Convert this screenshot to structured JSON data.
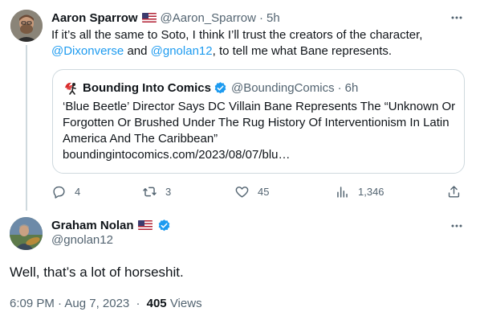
{
  "tweet1": {
    "name": "Aaron Sparrow",
    "handle": "@Aaron_Sparrow",
    "time": "5h",
    "text_a": "If it’s all the same to Soto, I think I’ll trust the creators of the character,",
    "mention_1": "@Dixonverse",
    "text_and": "and",
    "mention_2": "@gnolan12",
    "text_b": ", to tell me what Bane represents.",
    "quote": {
      "name": "Bounding Into Comics",
      "handle": "@BoundingComics",
      "time": "6h",
      "text": "‘Blue Beetle’ Director Says DC Villain Bane Represents The “Unknown Or Forgotten Or Brushed Under The Rug History Of Interventionism In Latin America And The Caribbean”",
      "link": "boundingintocomics.com/2023/08/07/blu…"
    },
    "actions": {
      "replies": "4",
      "retweets": "3",
      "likes": "45",
      "views": "1,346"
    }
  },
  "tweet2": {
    "name": "Graham Nolan",
    "handle": "@gnolan12",
    "text": "Well, that’s a lot of horseshit.",
    "time": "6:09 PM · Aug 7, 2023",
    "views_count": "405",
    "views_label": "Views"
  },
  "colors": {
    "accent": "#1d9bf0",
    "muted": "#536471",
    "border": "#cfd9de"
  },
  "icons": [
    "more-icon",
    "flag-us-icon",
    "verified-icon",
    "reply-icon",
    "retweet-icon",
    "like-icon",
    "views-icon",
    "share-icon"
  ]
}
